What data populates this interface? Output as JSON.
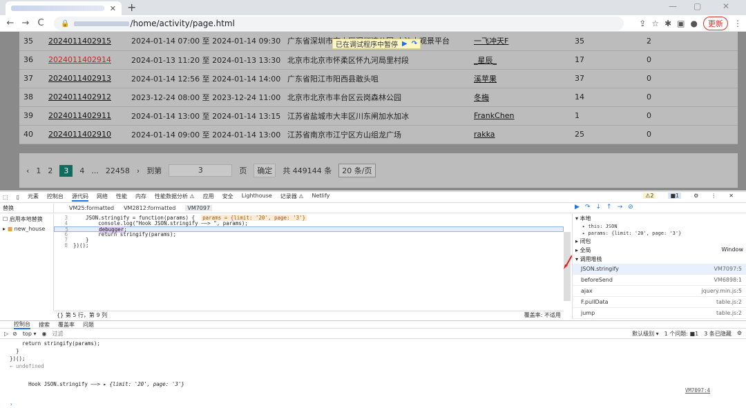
{
  "browser": {
    "new_tab": "+",
    "win_min": "—",
    "win_max": "▢",
    "win_close": "✕",
    "back": "←",
    "forward": "→",
    "reload": "C",
    "url_suffix": "/home/activity/page.html",
    "update_label": "更新"
  },
  "paused_banner": "已在调试程序中暂停",
  "table": {
    "rows": [
      {
        "index": "35",
        "id": "2024011402915",
        "time": "2024-01-14 07:00 至 2024-01-14 09:30",
        "location": "广东省深圳市南山区深圳湾公园-小沙山观景平台",
        "user": "一飞冲天F",
        "count": "35",
        "extra": "2",
        "id_red": false
      },
      {
        "index": "36",
        "id": "2024011402914",
        "time": "2024-01-13 11:20 至 2024-01-13 13:30",
        "location": "北京市北京市怀柔区怀九河局里村段",
        "user": "_星辰_",
        "count": "17",
        "extra": "0",
        "id_red": true
      },
      {
        "index": "37",
        "id": "2024011402913",
        "time": "2024-01-14 12:56 至 2024-01-14 14:00",
        "location": "广东省阳江市阳西县敢头咀",
        "user": "溪苹果",
        "count": "37",
        "extra": "0",
        "id_red": false
      },
      {
        "index": "38",
        "id": "2024011402912",
        "time": "2023-12-24 08:00 至 2023-12-24 11:00",
        "location": "北京市北京市丰台区云岗森林公园",
        "user": "冬梅",
        "count": "14",
        "extra": "0",
        "id_red": false
      },
      {
        "index": "39",
        "id": "2024011402911",
        "time": "2024-01-14 13:00 至 2024-01-14 13:15",
        "location": "江苏省盐城市大丰区川东闸加水加冰",
        "user": "FrankChen",
        "count": "1",
        "extra": "0",
        "id_red": false
      },
      {
        "index": "40",
        "id": "2024011402910",
        "time": "2024-01-14 09:00 至 2024-01-14 13:00",
        "location": "江苏省南京市江宁区方山组龙广场",
        "user": "rakka",
        "count": "25",
        "extra": "0",
        "id_red": false
      }
    ]
  },
  "pager": {
    "prev": "‹",
    "p1": "1",
    "p2": "2",
    "p3": "3",
    "p4": "4",
    "ellipsis": "...",
    "last": "22458",
    "next": "›",
    "goto_label": "到第",
    "goto_value": "3",
    "page_unit": "页",
    "confirm": "确定",
    "total": "共 449144 条",
    "page_size": "20 条/页"
  },
  "devtools": {
    "tabs": [
      "元素",
      "控制台",
      "源代码",
      "网络",
      "性能",
      "内存",
      "性能数据分析 ⚠",
      "应用",
      "安全",
      "Lighthouse",
      "记录器 ⚠",
      "Netlify"
    ],
    "warn_count": "⚠2",
    "err_count": "■1",
    "left_tab": "替换",
    "files": [
      "VM25:formatted",
      "VM2812:formatted",
      "VM7097"
    ],
    "nav_enable": "启用本地替换",
    "nav_folder": "new_house",
    "code_lines": [
      {
        "n": "3",
        "t": "    JSON.stringify = function(params) {  ",
        "inline": "params = {limit: '20', page: '3'}"
      },
      {
        "n": "4",
        "t": "        console.log(\"Hook JSON.stringify ——> \", params);"
      },
      {
        "n": "5",
        "t": "        ",
        "kw": "debugger",
        "after": ";"
      },
      {
        "n": "6",
        "t": "        return stringify(params);"
      },
      {
        "n": "7",
        "t": "    }"
      },
      {
        "n": "8",
        "t": "})();"
      }
    ],
    "status": "第 5 行，第 9 列",
    "status_right": "覆盖率: 不适用",
    "scope_local": "▾ 本地",
    "scope_this": "▸ this: JSON",
    "scope_params": "▸ params: {limit: '20', page: '3'}",
    "scope_closure": "▸ 闭包",
    "scope_global": "▸ 全局",
    "scope_global_val": "Window",
    "callstack_title": "▾ 调用堆栈",
    "frames": [
      {
        "fn": "JSON.stringify",
        "loc": "VM7097:5"
      },
      {
        "fn": "beforeSend",
        "loc": "VM6898:1"
      },
      {
        "fn": "ajax",
        "loc": "jquery.min.js:5"
      },
      {
        "fn": "F.pullData",
        "loc": "table.js:2"
      },
      {
        "fn": "jump",
        "loc": "table.js:2"
      }
    ],
    "console_tabs": [
      "控制台",
      "搜索",
      "覆盖率",
      "问题"
    ],
    "context": "top ▾",
    "filter_placeholder": "过滤",
    "levels": "默认级别 ▾",
    "issues": "1 个问题: ■1",
    "hidden": "3 条已隐藏",
    "console_lines": [
      "    return stringify(params);",
      "  }",
      "})();",
      "← undefined"
    ],
    "log_text": "Hook JSON.stringify ——> ",
    "log_obj": "▸ {limit: '20', page: '3'}",
    "log_src": "VM7097:4",
    "prompt": "›"
  }
}
